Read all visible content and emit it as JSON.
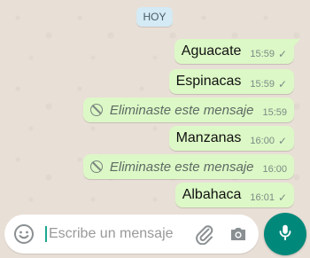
{
  "chat": {
    "date_chip": "HOY",
    "messages": [
      {
        "text": "Aguacate",
        "time": "15:59",
        "deleted": false
      },
      {
        "text": "Espinacas",
        "time": "15:59",
        "deleted": false
      },
      {
        "text": "Eliminaste este mensaje",
        "time": "15:59",
        "deleted": true
      },
      {
        "text": "Manzanas",
        "time": "16:00",
        "deleted": false
      },
      {
        "text": "Eliminaste este mensaje",
        "time": "16:00",
        "deleted": true
      },
      {
        "text": "Albahaca",
        "time": "16:01",
        "deleted": false
      }
    ],
    "check_glyph": "✓"
  },
  "composer": {
    "placeholder": "Escribe un mensaje",
    "icons": [
      "emoji-icon",
      "attach-icon",
      "camera-icon",
      "microphone-icon"
    ]
  },
  "colors": {
    "outgoing_bubble": "#dcf8c6",
    "accent": "#00897b",
    "date_chip": "#d4eaf4"
  }
}
